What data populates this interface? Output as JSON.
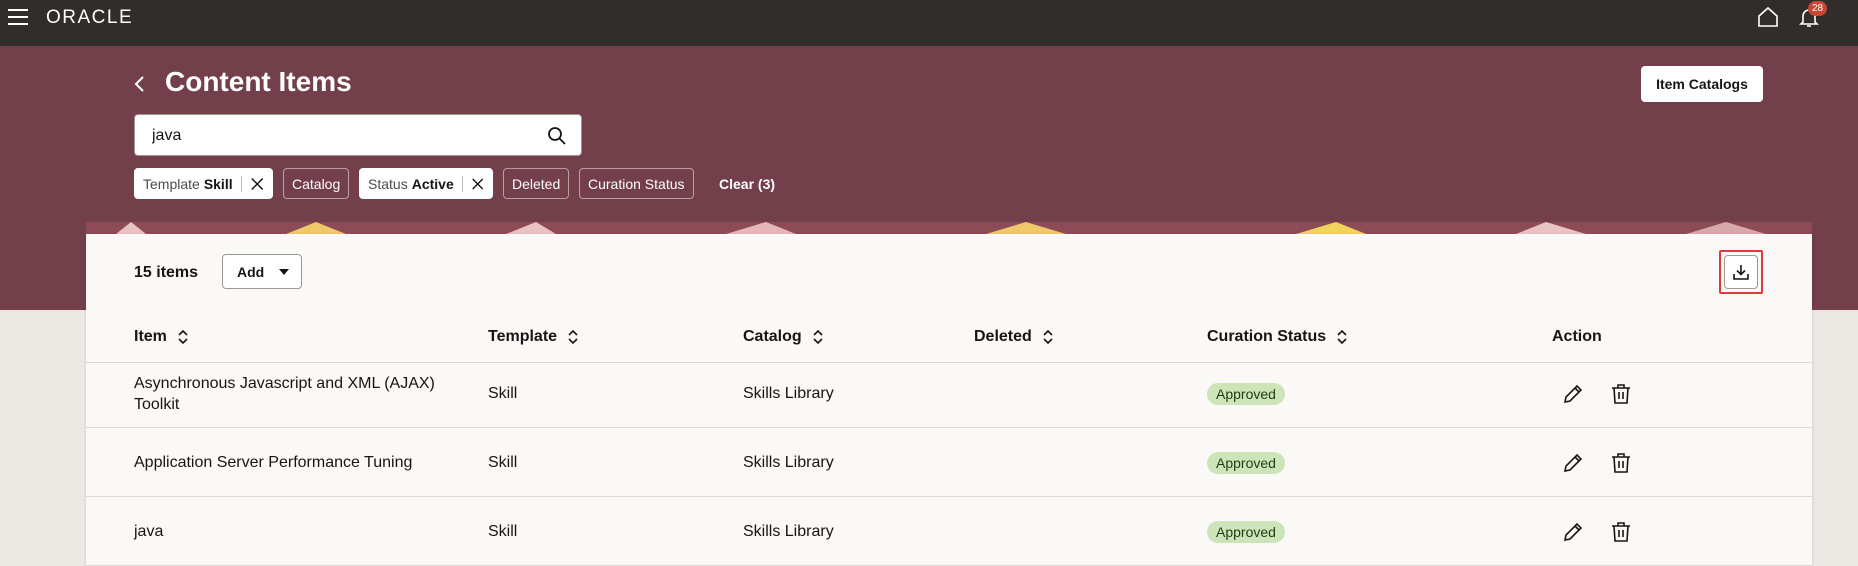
{
  "topbar": {
    "logo": "ORACLE",
    "notification_count": "28"
  },
  "header": {
    "title": "Content Items",
    "item_catalogs_label": "Item Catalogs"
  },
  "search": {
    "value": "java"
  },
  "filters": {
    "template": {
      "label": "Template",
      "value": "Skill"
    },
    "catalog": {
      "label": "Catalog"
    },
    "status": {
      "label": "Status",
      "value": "Active"
    },
    "deleted": {
      "label": "Deleted"
    },
    "curation_status": {
      "label": "Curation Status"
    },
    "clear_label": "Clear (3)"
  },
  "toolbar": {
    "count": "15 items",
    "add_label": "Add"
  },
  "table": {
    "columns": [
      "Item",
      "Template",
      "Catalog",
      "Deleted",
      "Curation Status",
      "Action"
    ],
    "rows": [
      {
        "item_line1": "Asynchronous Javascript and XML (AJAX)",
        "item_line2": "Toolkit",
        "template": "Skill",
        "catalog": "Skills Library",
        "deleted": "",
        "status": "Approved"
      },
      {
        "item_line1": "Application Server Performance Tuning",
        "item_line2": "",
        "template": "Skill",
        "catalog": "Skills Library",
        "deleted": "",
        "status": "Approved"
      },
      {
        "item_line1": "java",
        "item_line2": "",
        "template": "Skill",
        "catalog": "Skills Library",
        "deleted": "",
        "status": "Approved"
      }
    ]
  },
  "colors": {
    "topbar": "#312d2a",
    "hero": "#723f4b",
    "status_bg": "#cde4b9",
    "highlight": "#e03a3a"
  },
  "icons": [
    "hamburger-icon",
    "home-icon",
    "bell-icon",
    "back-arrow-icon",
    "search-icon",
    "close-icon",
    "caret-down-icon",
    "download-icon",
    "sort-icon",
    "edit-icon",
    "delete-icon"
  ]
}
